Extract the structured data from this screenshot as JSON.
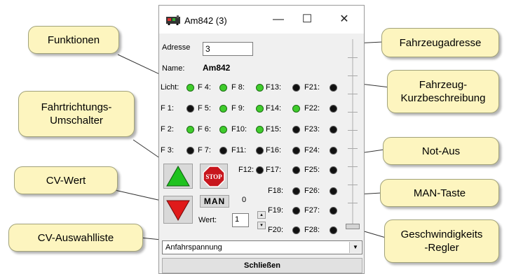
{
  "window": {
    "title": "Am842 (3)",
    "minimize": "—",
    "maximize": "☐",
    "close": "✕"
  },
  "fields": {
    "adresse_label": "Adresse",
    "adresse_value": "3",
    "name_label": "Name:",
    "name_value": "Am842"
  },
  "functions": [
    {
      "label": "Licht:",
      "state": "on"
    },
    {
      "label": "F 4:",
      "state": "on"
    },
    {
      "label": "F 8:",
      "state": "on"
    },
    {
      "label": "F13:",
      "state": "off"
    },
    {
      "label": "F21:",
      "state": "off"
    },
    {
      "label": "F 1:",
      "state": "off"
    },
    {
      "label": "F 5:",
      "state": "on"
    },
    {
      "label": "F 9:",
      "state": "on"
    },
    {
      "label": "F14:",
      "state": "on"
    },
    {
      "label": "F22:",
      "state": "off"
    },
    {
      "label": "F 2:",
      "state": "on"
    },
    {
      "label": "F 6:",
      "state": "on"
    },
    {
      "label": "F10:",
      "state": "on"
    },
    {
      "label": "F15:",
      "state": "off"
    },
    {
      "label": "F23:",
      "state": "off"
    },
    {
      "label": "F 3:",
      "state": "off"
    },
    {
      "label": "F 7:",
      "state": "off"
    },
    {
      "label": "F11:",
      "state": "off"
    },
    {
      "label": "F16:",
      "state": "off"
    },
    {
      "label": "F24:",
      "state": "off"
    },
    {
      "label": "F12:",
      "state": "off"
    },
    {
      "label": "F17:",
      "state": "off"
    },
    {
      "label": "F25:",
      "state": "off"
    },
    {
      "label": "F18:",
      "state": "off"
    },
    {
      "label": "F26:",
      "state": "off"
    },
    {
      "label": "F19:",
      "state": "off"
    },
    {
      "label": "F27:",
      "state": "off"
    },
    {
      "label": "F20:",
      "state": "off"
    },
    {
      "label": "F28:",
      "state": "off"
    }
  ],
  "controls": {
    "stop_label": "STOP",
    "man_label": "MAN",
    "speed_value": "0",
    "wert_label": "Wert:",
    "wert_value": "1",
    "cv_selected": "Anfahrspannung",
    "close_button": "Schließen"
  },
  "callouts": {
    "funktionen": "Funktionen",
    "fahrtrichtung": "Fahrtrichtungs-\nUmschalter",
    "cv_wert": "CV-Wert",
    "cv_auswahl": "CV-Auswahlliste",
    "fahrzeugadresse": "Fahrzeugadresse",
    "kurzbeschreibung": "Fahrzeug-\nKurzbeschreibung",
    "not_aus": "Not-Aus",
    "man_taste": "MAN-Taste",
    "regler": "Geschwindigkeits\n-Regler"
  },
  "colors": {
    "callout_fill": "#fdf5bf",
    "led_on": "#3fcc2c",
    "led_off": "#111111",
    "forward_arrow": "#1fc21f",
    "reverse_arrow": "#e01a1a",
    "stop_sign": "#c8161d"
  }
}
